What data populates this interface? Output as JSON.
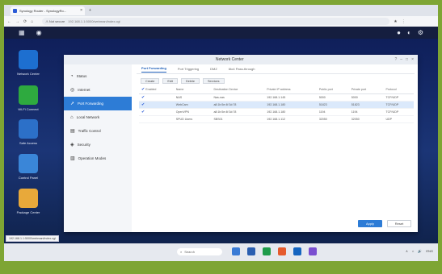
{
  "browser": {
    "tab_title": "Synology Router - SynologyRo...",
    "tab_close": "×",
    "new_tab": "+",
    "nav": [
      "←",
      "→",
      "⟳",
      "⌂"
    ],
    "not_secure": "⚠ Not secure",
    "url": "192.168.1.1:5000/webman/index.cgi",
    "toolbar_icons": [
      "★",
      "⋮"
    ]
  },
  "dsm": {
    "left_icons": [
      "▦",
      "◉"
    ],
    "right_icons": [
      "●",
      "◐",
      "⚙"
    ]
  },
  "desktop_icons": [
    {
      "label": "Network Center",
      "color": "#1d6fd0"
    },
    {
      "label": "Wi-Fi Connect",
      "color": "#2eaa3f"
    },
    {
      "label": "Safe Access",
      "color": "#2c70c8"
    },
    {
      "label": "Control Panel",
      "color": "#3a86d8"
    },
    {
      "label": "Package Center",
      "color": "#e8a93a"
    }
  ],
  "window": {
    "title": "Network Center",
    "controls": [
      "?",
      "–",
      "□",
      "×"
    ],
    "sidebar": [
      {
        "icon": "◔",
        "label": "Status",
        "active": false
      },
      {
        "icon": "◎",
        "label": "Internet",
        "active": false
      },
      {
        "icon": "➚",
        "label": "Port Forwarding",
        "active": true
      },
      {
        "icon": "⌂",
        "label": "Local Network",
        "active": false
      },
      {
        "icon": "▤",
        "label": "Traffic Control",
        "active": false
      },
      {
        "icon": "◈",
        "label": "Security",
        "active": false
      },
      {
        "icon": "▥",
        "label": "Operation Modes",
        "active": false
      }
    ],
    "tabs": [
      "Port Forwarding",
      "Port Triggering",
      "DMZ",
      "6to4 Pass-through"
    ],
    "toolbar": [
      "Create",
      "Edit",
      "Delete",
      "Services"
    ],
    "columns": [
      "Enabled",
      "Name",
      "Destination Device",
      "Private IP address",
      "Public port",
      "Private port",
      "Protocol"
    ],
    "rows": [
      {
        "enabled": true,
        "name": "NAS",
        "device": "Nas-nas",
        "ip": "192.168.1.145",
        "pub": "5000",
        "priv": "5000",
        "proto": "TCP/UDP",
        "selected": false
      },
      {
        "enabled": true,
        "name": "WebCam",
        "device": "a8:1b:5e:4f:3d:78",
        "ip": "192.168.1.180",
        "pub": "51823",
        "priv": "51823",
        "proto": "TCP/UDP",
        "selected": true
      },
      {
        "enabled": true,
        "name": "OpenVPN",
        "device": "a8:1b:5e:4f:3d:78",
        "ip": "192.168.1.180",
        "pub": "1194",
        "priv": "1194",
        "proto": "TCP/UDP",
        "selected": false
      },
      {
        "enabled": false,
        "name": "SPUD Users",
        "device": "SBS01",
        "ip": "192.168.1.112",
        "pub": "32050",
        "priv": "32050",
        "proto": "UDP",
        "selected": false
      }
    ],
    "apply": "Apply",
    "reset": "Reset"
  },
  "status_url": "192.168.1.1:5000/webman/index.cgi",
  "taskbar": {
    "search": "Search",
    "tray": [
      "∧",
      "⌂",
      "🔊",
      "ENG"
    ],
    "apps": [
      "#3a7bd5",
      "#2b5fb0",
      "#1f9c4a",
      "#e55b2d",
      "#1565c0",
      "#7a4fd0"
    ]
  }
}
